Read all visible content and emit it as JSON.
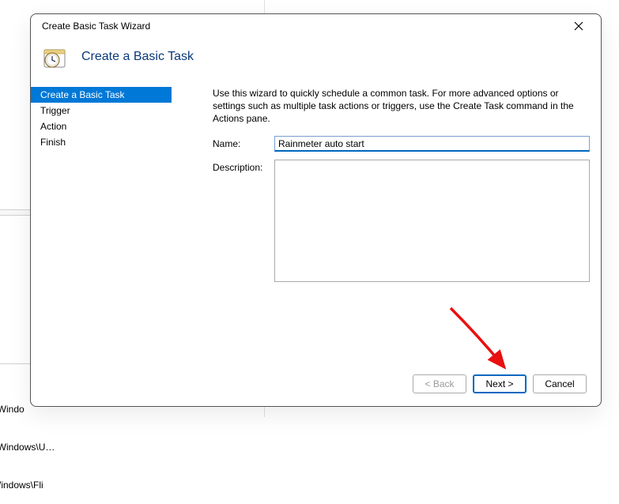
{
  "background": {
    "path1": "oft\\Windo",
    "path2": "oft\\Windows\\U…",
    "path3": "ft\\Windows\\Fli"
  },
  "dialog": {
    "title": "Create Basic Task Wizard",
    "header": "Create a Basic Task",
    "instructions": "Use this wizard to quickly schedule a common task.  For more advanced options or settings such as multiple task actions or triggers, use the Create Task command in the Actions pane.",
    "name_label": "Name:",
    "name_value": "Rainmeter auto start",
    "description_label": "Description:",
    "description_value": ""
  },
  "sidebar": {
    "items": [
      {
        "label": "Create a Basic Task",
        "active": true
      },
      {
        "label": "Trigger",
        "active": false
      },
      {
        "label": "Action",
        "active": false
      },
      {
        "label": "Finish",
        "active": false
      }
    ]
  },
  "buttons": {
    "back": "< Back",
    "next": "Next >",
    "cancel": "Cancel"
  }
}
